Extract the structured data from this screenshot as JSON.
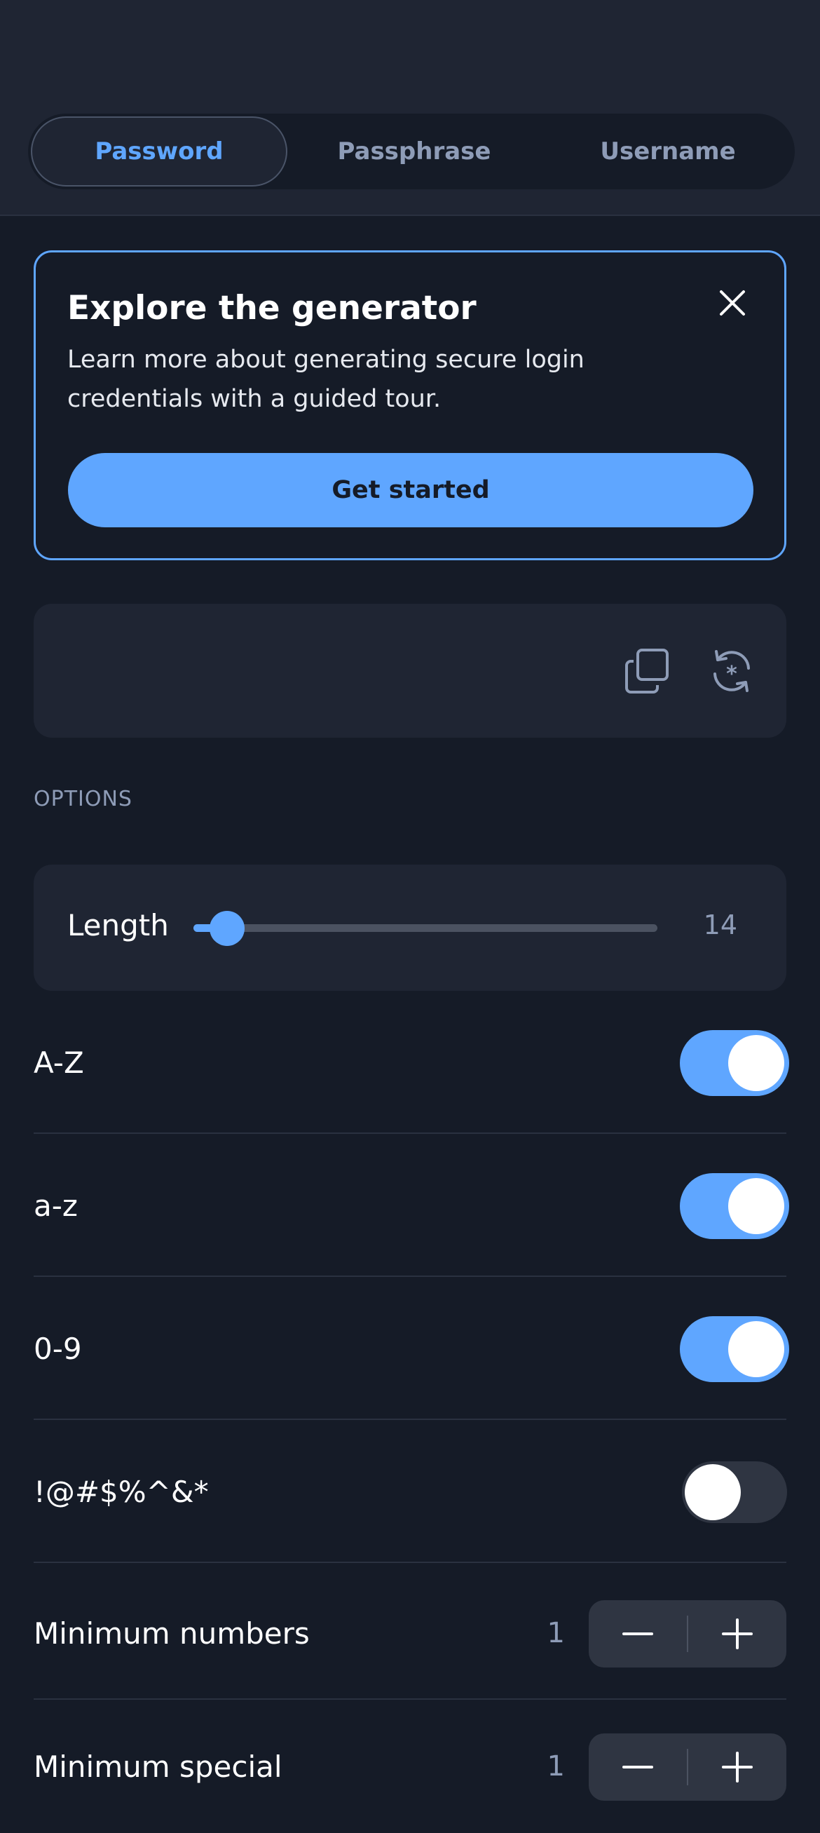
{
  "tabs": [
    {
      "label": "Password",
      "active": true
    },
    {
      "label": "Passphrase",
      "active": false
    },
    {
      "label": "Username",
      "active": false
    }
  ],
  "promo": {
    "title": "Explore the generator",
    "body": "Learn more about generating secure login credentials with a guided tour.",
    "cta_label": "Get started",
    "close_icon": "close-icon"
  },
  "generated": {
    "value": "",
    "copy_icon": "copy-icon",
    "regenerate_icon": "regenerate-icon"
  },
  "options": {
    "section_label": "OPTIONS",
    "length": {
      "label": "Length",
      "value": "14",
      "min": 5,
      "max": 128
    },
    "toggles": [
      {
        "label": "A-Z",
        "on": true
      },
      {
        "label": "a-z",
        "on": true
      },
      {
        "label": "0-9",
        "on": true
      },
      {
        "label": "!@#$%^&*",
        "on": false
      }
    ],
    "steppers": [
      {
        "label": "Minimum numbers",
        "value": "1"
      },
      {
        "label": "Minimum special",
        "value": "1"
      }
    ]
  },
  "colors": {
    "accent": "#5fa6ff",
    "background": "#151b27",
    "surface": "#1f2533",
    "muted_text": "#8e9cb7"
  }
}
